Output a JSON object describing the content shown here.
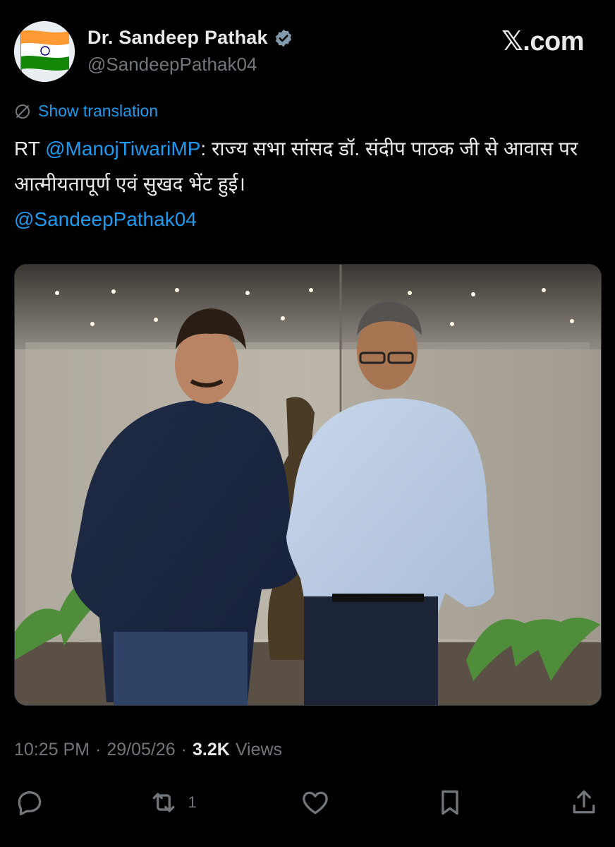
{
  "header": {
    "display_name": "Dr. Sandeep Pathak",
    "handle": "@SandeepPathak04",
    "brand": "𝕏.com",
    "avatar_icon": "india-flag-icon",
    "verified_icon": "verified-badge-icon"
  },
  "translation": {
    "label": "Show translation",
    "icon": "translate-icon"
  },
  "tweet": {
    "rt_prefix": "RT ",
    "mention_1": "@ManojTiwariMP",
    "body": ": राज्य सभा सांसद डॉ. संदीप पाठक जी से आवास पर आत्मीयतापूर्ण एवं सुखद भेंट हुई।",
    "mention_2": "@SandeepPathak04"
  },
  "meta": {
    "time": "10:25 PM",
    "separator": "·",
    "date": "29/05/26",
    "views_count": "3.2K",
    "views_label": "Views"
  },
  "actions": {
    "reply_icon": "reply-icon",
    "retweet_icon": "retweet-icon",
    "retweet_count": "1",
    "like_icon": "heart-icon",
    "bookmark_icon": "bookmark-icon",
    "share_icon": "share-icon"
  },
  "colors": {
    "background": "#000000",
    "text_primary": "#e7e9ea",
    "text_secondary": "#71767b",
    "link": "#1d9bf0",
    "verified": "#829aab"
  }
}
